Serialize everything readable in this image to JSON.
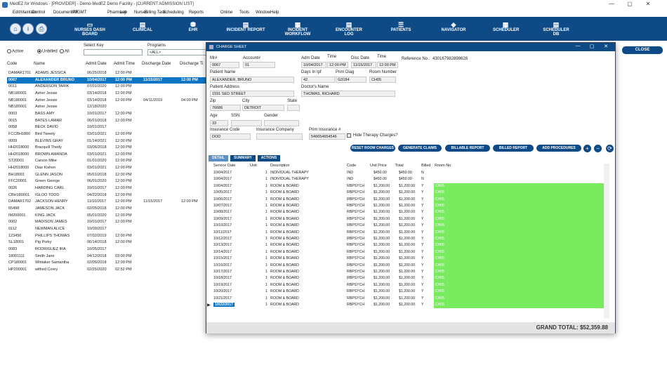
{
  "window": {
    "title": "MedEZ for Windows - [PROVIDER] - Demo-MedEZ Demo Facility - [CURRENT ADMISSION LIST]"
  },
  "menu": [
    "Edit",
    "Maintain",
    "Control",
    "Document MGMT",
    "IPF",
    "Pharmacy",
    "Lab",
    "Nurses",
    "Billing Task",
    "Scheduling",
    "Reports",
    "Online",
    "Tools",
    "Window",
    "Help"
  ],
  "toolbar": {
    "items": [
      "NURSES DASH BOARD",
      "CLINICAL",
      "EHR",
      "INCIDENT REPORT",
      "INCIDENT WORKFLOW",
      "ENCOUNTER LOG",
      "PATIENTS",
      "NAVIGATOR",
      "SCHEDULER",
      "SCHEDULER DB"
    ]
  },
  "filter": {
    "radios": [
      "Active",
      "Unbilled",
      "All"
    ],
    "selected": "Unbilled",
    "select_key_label": "Select Key",
    "programs_label": "Programs",
    "programs_value": "<ALL>"
  },
  "close_label": "CLOSE",
  "grid": {
    "headers": [
      "Code",
      "Name",
      "Admit Date",
      "Admit Time",
      "Discharge Date",
      "Discharge Ti"
    ],
    "rows": [
      [
        "DAMAR1701",
        "ADAMS JESSICA",
        "06/25/2018",
        "12:00 PM",
        "",
        ""
      ],
      [
        "0067",
        "ALEXANDER BRUNO",
        "10/04/2017",
        "12:00 PM",
        "11/15/2017",
        "12:00 PM"
      ],
      [
        "0011",
        "ANDERSON TARIK",
        "07/01/2020",
        "12:00 PM",
        "",
        ""
      ],
      [
        "NB180001",
        "Asher Jessie",
        "03/14/2018",
        "12:00 PM",
        "",
        ""
      ],
      [
        "NB180001",
        "Asher Jessie",
        "03/14/2018",
        "12:00 PM",
        "04/11/2019",
        "04:00 PM"
      ],
      [
        "NB180001",
        "Asher Jessie",
        "12/18/2020",
        "",
        "",
        ""
      ],
      [
        "0003",
        "BASS AMY",
        "10/01/2017",
        "12:00 PM",
        "",
        ""
      ],
      [
        "0015",
        "BATES LAMAR",
        "06/01/2018",
        "12:00 PM",
        "",
        ""
      ],
      [
        "0058",
        "BECK DAVID",
        "10/01/2017",
        "",
        "",
        ""
      ],
      [
        "FCCBH1800",
        "Bird Tweety",
        "03/01/2021",
        "12:00 PM",
        "",
        ""
      ],
      [
        "0009",
        "BLEVINS GRAY",
        "01/14/2021",
        "12:00 PM",
        "",
        ""
      ],
      [
        "HH2018000",
        "Bracquill Thedy",
        "03/06/2018",
        "12:00 PM",
        "",
        ""
      ],
      [
        "HH2018000",
        "BROWN AMANDA",
        "03/01/2021",
        "12:00 PM",
        "",
        ""
      ],
      [
        "ST20001",
        "Carson Mike",
        "01/01/2020",
        "12:00 PM",
        "",
        ""
      ],
      [
        "HH2018000",
        "Diaz Kishon",
        "03/01/2021",
        "12:00 PM",
        "",
        ""
      ],
      [
        "BH18001",
        "GLENN JASON",
        "05/01/2018",
        "12:00 PM",
        "",
        ""
      ],
      [
        "FFC20001",
        "Green George",
        "06/01/2020",
        "12:00 PM",
        "",
        ""
      ],
      [
        "0026",
        "HARDING CARL",
        "10/01/2017",
        "12:00 PM",
        "",
        ""
      ],
      [
        "CBH180001",
        "IGLOO TODD",
        "04/22/2018",
        "12:00 PM",
        "",
        ""
      ],
      [
        "DAMAR1702",
        "JACKSON HENRY",
        "11/10/2017",
        "12:00 PM",
        "11/15/2017",
        "12:00 PM"
      ],
      [
        "65498",
        "JAMESON JACK",
        "02/05/2018",
        "12:00 PM",
        "",
        ""
      ],
      [
        "IM200001",
        "KING JACK",
        "05/01/2020",
        "12:00 PM",
        "",
        ""
      ],
      [
        "0002",
        "MADISON JAMES",
        "10/01/2017",
        "12:00 PM",
        "",
        ""
      ],
      [
        "0112",
        "NEWMAN ALICE",
        "10/09/2017",
        "",
        "",
        ""
      ],
      [
        "123456",
        "PHILLIPS THOMAS",
        "07/02/2019",
        "12:00 PM",
        "",
        ""
      ],
      [
        "SL18001",
        "Pig Porky",
        "06/14/2018",
        "12:00 PM",
        "",
        ""
      ],
      [
        "0083",
        "RODRIGUEZ IRA",
        "10/05/2017",
        "",
        "",
        ""
      ],
      [
        "18001111",
        "Smith Jane",
        "04/12/2018",
        "03:00 PM",
        "",
        ""
      ],
      [
        "CP180001",
        "Whitaker Samantha",
        "02/05/2018",
        "12:00 PM",
        "",
        ""
      ],
      [
        "HP200001",
        "wilfred Corey",
        "02/25/2020",
        "02:52 PM",
        "",
        ""
      ]
    ]
  },
  "modal": {
    "title": "CHARGE SHEET",
    "reference_label": "Reference No.:",
    "reference_value": "430167982898628",
    "fields": {
      "mr_label": "Mr#",
      "mr": "0067",
      "account_label": "Account#",
      "account": "01",
      "admit_date_label": "Adm Date",
      "admit_date": "10/04/2017",
      "time_label": "Time",
      "admit_time": "12:00 PM",
      "disc_date_label": "Disc Date",
      "disc_date": "11/15/2017",
      "disc_time_label": "Time",
      "disc_time": "12:00 PM",
      "patient_name_label": "Patient Name",
      "patient_name": "ALEXANDER, BRUNO",
      "days_label": "Days In Ipf",
      "days": "42",
      "prim_diag_label": "Prim Diag",
      "prim_diag": "G3184",
      "room_label": "Room Number",
      "room": "CH05",
      "address_label": "Patient Address",
      "address": "1591 SED STREET",
      "doctor_label": "Doctor's Name",
      "doctor": "THOMAS, RICHARD",
      "zip_label": "Zip",
      "zip": "76686",
      "city_label": "City",
      "city": "DETROIT",
      "state_label": "State",
      "state": "",
      "age_label": "Age",
      "age": "33",
      "ssn_label": "SSN",
      "ssn": "",
      "gender_label": "Gender",
      "gender": "",
      "ins_code_label": "Insurance Code",
      "ins_code": "DOD",
      "ins_company_label": "Insurance Company",
      "ins_company": "",
      "prim_ins_label": "Prim Insurance #",
      "prim_ins": "546654654546",
      "hide_therapy_label": "Hide Therapy Charges?"
    },
    "buttons": [
      "RESET ROOM CHARGES",
      "GENERATE CLAIMS",
      "BILLABLE REPORT",
      "BILLED REPORT",
      "ADD PROCEDURES"
    ],
    "round_buttons": [
      "+",
      "−",
      "⟳"
    ],
    "tabs": [
      "DETAIL",
      "SUMMARY",
      "ACTIONS"
    ],
    "table": {
      "headers": [
        "Service Date",
        "Unit",
        "Description",
        "Code",
        "Unit Price",
        "Total",
        "Billed",
        "Room No"
      ],
      "rows": [
        [
          "10/04/2017",
          "1",
          "INDIVIDUAL THERAPY",
          "IND",
          "$450.00",
          "$450.00",
          "N",
          ""
        ],
        [
          "10/04/2017",
          "1",
          "INDIVIDUAL THERAPY",
          "IND",
          "$450.00",
          "$450.00",
          "N",
          ""
        ],
        [
          "10/04/2017",
          "1",
          "ROOM & BOARD",
          "RBPSYCH",
          "$1,200.00",
          "$1,200.00",
          "Y",
          "CH05"
        ],
        [
          "10/05/2017",
          "1",
          "ROOM & BOARD",
          "RBPSYCH",
          "$1,200.00",
          "$1,200.00",
          "Y",
          "CH05"
        ],
        [
          "10/06/2017",
          "1",
          "ROOM & BOARD",
          "RBPSYCH",
          "$1,200.00",
          "$1,200.00",
          "Y",
          "CH05"
        ],
        [
          "10/07/2017",
          "1",
          "ROOM & BOARD",
          "RBPSYCH",
          "$1,200.00",
          "$1,200.00",
          "Y",
          "CH05"
        ],
        [
          "10/08/2017",
          "1",
          "ROOM & BOARD",
          "RBPSYCH",
          "$1,200.00",
          "$1,200.00",
          "Y",
          "CH05"
        ],
        [
          "10/09/2017",
          "1",
          "ROOM & BOARD",
          "RBPSYCH",
          "$1,200.00",
          "$1,200.00",
          "Y",
          "CH05"
        ],
        [
          "10/10/2017",
          "1",
          "ROOM & BOARD",
          "RBPSYCH",
          "$1,200.00",
          "$1,200.00",
          "Y",
          "CH05"
        ],
        [
          "10/11/2017",
          "1",
          "ROOM & BOARD",
          "RBPSYCH",
          "$1,200.00",
          "$1,200.00",
          "Y",
          "CH05"
        ],
        [
          "10/12/2017",
          "1",
          "ROOM & BOARD",
          "RBPSYCH",
          "$1,200.00",
          "$1,200.00",
          "Y",
          "CH05"
        ],
        [
          "10/13/2017",
          "1",
          "ROOM & BOARD",
          "RBPSYCH",
          "$1,200.00",
          "$1,200.00",
          "Y",
          "CH05"
        ],
        [
          "10/14/2017",
          "1",
          "ROOM & BOARD",
          "RBPSYCH",
          "$1,200.00",
          "$1,200.00",
          "Y",
          "CH05"
        ],
        [
          "10/15/2017",
          "1",
          "ROOM & BOARD",
          "RBPSYCH",
          "$1,200.00",
          "$1,200.00",
          "Y",
          "CH05"
        ],
        [
          "10/16/2017",
          "1",
          "ROOM & BOARD",
          "RBPSYCH",
          "$1,200.00",
          "$1,200.00",
          "Y",
          "CH05"
        ],
        [
          "10/17/2017",
          "1",
          "ROOM & BOARD",
          "RBPSYCH",
          "$1,200.00",
          "$1,200.00",
          "Y",
          "CH05"
        ],
        [
          "10/18/2017",
          "1",
          "ROOM & BOARD",
          "RBPSYCH",
          "$1,200.00",
          "$1,200.00",
          "Y",
          "CH05"
        ],
        [
          "10/19/2017",
          "1",
          "ROOM & BOARD",
          "RBPSYCH",
          "$1,200.00",
          "$1,200.00",
          "Y",
          "CH05"
        ],
        [
          "10/20/2017",
          "1",
          "ROOM & BOARD",
          "RBPSYCH",
          "$1,200.00",
          "$1,200.00",
          "Y",
          "CH05"
        ],
        [
          "10/21/2017",
          "1",
          "ROOM & BOARD",
          "RBPSYCH",
          "$1,200.00",
          "$1,200.00",
          "Y",
          "CH05"
        ],
        [
          "10/22/2017",
          "1",
          "ROOM & BOARD",
          "RBPSYCH",
          "$1,200.00",
          "$1,200.00",
          "Y",
          "CH05"
        ]
      ]
    },
    "grand_total": "GRAND TOTAL: $52,359.88"
  },
  "colors": {
    "brand": "#0e4a86",
    "selected": "#0c75c4",
    "room_green": "#78ec5e"
  }
}
